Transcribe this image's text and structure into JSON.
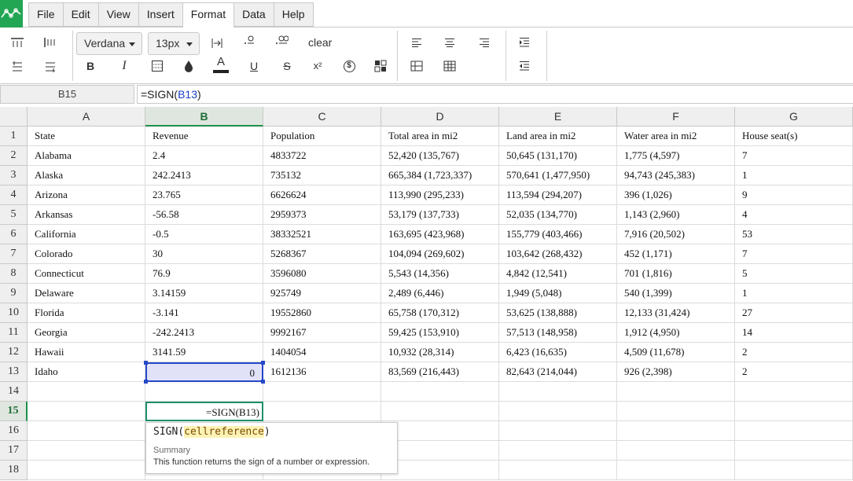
{
  "menu": {
    "items": [
      {
        "label": "File"
      },
      {
        "label": "Edit"
      },
      {
        "label": "View"
      },
      {
        "label": "Insert"
      },
      {
        "label": "Format",
        "active": true
      },
      {
        "label": "Data"
      },
      {
        "label": "Help"
      }
    ]
  },
  "toolbar": {
    "font_family": "Verdana",
    "font_size": "13px",
    "clear_label": "clear",
    "bold_label": "B",
    "italic_label": "I",
    "font_color_label": "A",
    "underline_label": "U",
    "strike_label": "S",
    "superscript_label": "x²",
    "currency_label": "$"
  },
  "formula_bar": {
    "cell_ref": "B15",
    "formula_prefix": "=SIGN(",
    "formula_ref": "B13",
    "formula_suffix": ")"
  },
  "columns": [
    "A",
    "B",
    "C",
    "D",
    "E",
    "F",
    "G"
  ],
  "rows": [
    "1",
    "2",
    "3",
    "4",
    "5",
    "6",
    "7",
    "8",
    "9",
    "10",
    "11",
    "12",
    "13",
    "14",
    "15",
    "16",
    "17",
    "18"
  ],
  "table": {
    "headers": [
      "State",
      "Revenue",
      "Population",
      "Total area in mi2",
      "Land area in mi2",
      "Water area in mi2",
      "House seat(s)"
    ],
    "rows": [
      [
        "Alabama",
        "2.4",
        "4833722",
        "52,420 (135,767)",
        "50,645 (131,170)",
        "1,775 (4,597)",
        "7"
      ],
      [
        "Alaska",
        "242.2413",
        "735132",
        "665,384 (1,723,337)",
        "570,641 (1,477,950)",
        "94,743 (245,383)",
        "1"
      ],
      [
        "Arizona",
        "23.765",
        "6626624",
        "113,990 (295,233)",
        "113,594 (294,207)",
        "396 (1,026)",
        "9"
      ],
      [
        "Arkansas",
        "-56.58",
        "2959373",
        "53,179 (137,733)",
        "52,035 (134,770)",
        "1,143 (2,960)",
        "4"
      ],
      [
        "California",
        "-0.5",
        "38332521",
        "163,695 (423,968)",
        "155,779 (403,466)",
        "7,916 (20,502)",
        "53"
      ],
      [
        "Colorado",
        "30",
        "5268367",
        "104,094 (269,602)",
        "103,642 (268,432)",
        "452 (1,171)",
        "7"
      ],
      [
        "Connecticut",
        "76.9",
        "3596080",
        "5,543 (14,356)",
        "4,842 (12,541)",
        "701 (1,816)",
        "5"
      ],
      [
        "Delaware",
        "3.14159",
        "925749",
        "2,489 (6,446)",
        "1,949 (5,048)",
        "540 (1,399)",
        "1"
      ],
      [
        "Florida",
        "-3.141",
        "19552860",
        "65,758 (170,312)",
        "53,625 (138,888)",
        "12,133 (31,424)",
        "27"
      ],
      [
        "Georgia",
        "-242.2413",
        "9992167",
        "59,425 (153,910)",
        "57,513 (148,958)",
        "1,912 (4,950)",
        "14"
      ],
      [
        "Hawaii",
        "3141.59",
        "1404054",
        "10,932 (28,314)",
        "6,423 (16,635)",
        "4,509 (11,678)",
        "2"
      ],
      [
        "Idaho",
        "0",
        "1612136",
        "83,569 (216,443)",
        "82,643 (214,044)",
        "926 (2,398)",
        "2"
      ]
    ]
  },
  "editing_cell": {
    "value": "=SIGN(B13)"
  },
  "autocomplete": {
    "func_name": "SIGN(",
    "param": "cellreference",
    "close": ")",
    "summary_heading": "Summary",
    "summary_text": "This function returns the sign of a number or expression."
  },
  "colors": {
    "brand_green": "#23a654",
    "selection_blue": "#2548c8",
    "selection_fill": "#e1e1f8",
    "active_header_green": "#1e8f4a"
  }
}
